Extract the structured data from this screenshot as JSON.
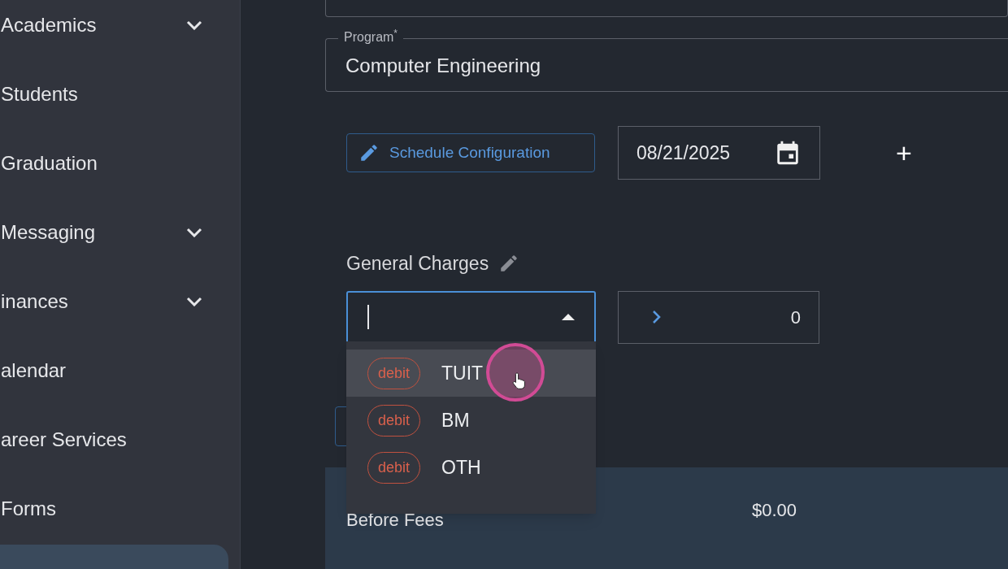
{
  "sidebar": {
    "items": [
      {
        "label": "Academics",
        "has_submenu": true,
        "selected": false
      },
      {
        "label": "Students",
        "has_submenu": false,
        "selected": false
      },
      {
        "label": "Graduation",
        "has_submenu": false,
        "selected": false
      },
      {
        "label": "Messaging",
        "has_submenu": true,
        "selected": false
      },
      {
        "label": "inances",
        "has_submenu": true,
        "selected": false
      },
      {
        "label": "alendar",
        "has_submenu": false,
        "selected": false
      },
      {
        "label": "areer Services",
        "has_submenu": false,
        "selected": false
      },
      {
        "label": "Forms",
        "has_submenu": false,
        "selected": false
      },
      {
        "selected": true
      }
    ]
  },
  "program_field": {
    "label": "Program$^{*}$",
    "value": "Computer Engineering"
  },
  "schedule_button": {
    "label": "Schedule Configuration"
  },
  "date_field": {
    "value": "08/21/2025"
  },
  "add_button": {
    "label": "+"
  },
  "general_charges": {
    "title": "General Charges",
    "combobox": {
      "expanded": true
    },
    "amount": {
      "value": "0"
    },
    "options": [
      {
        "tag": "debit",
        "code": "TUIT",
        "selected": true
      },
      {
        "tag": "debit",
        "code": "BM",
        "selected": false
      },
      {
        "tag": "debit",
        "code": "OTH",
        "selected": false
      }
    ]
  },
  "summary": {
    "label": "Before Fees",
    "value": "$0.00"
  }
}
